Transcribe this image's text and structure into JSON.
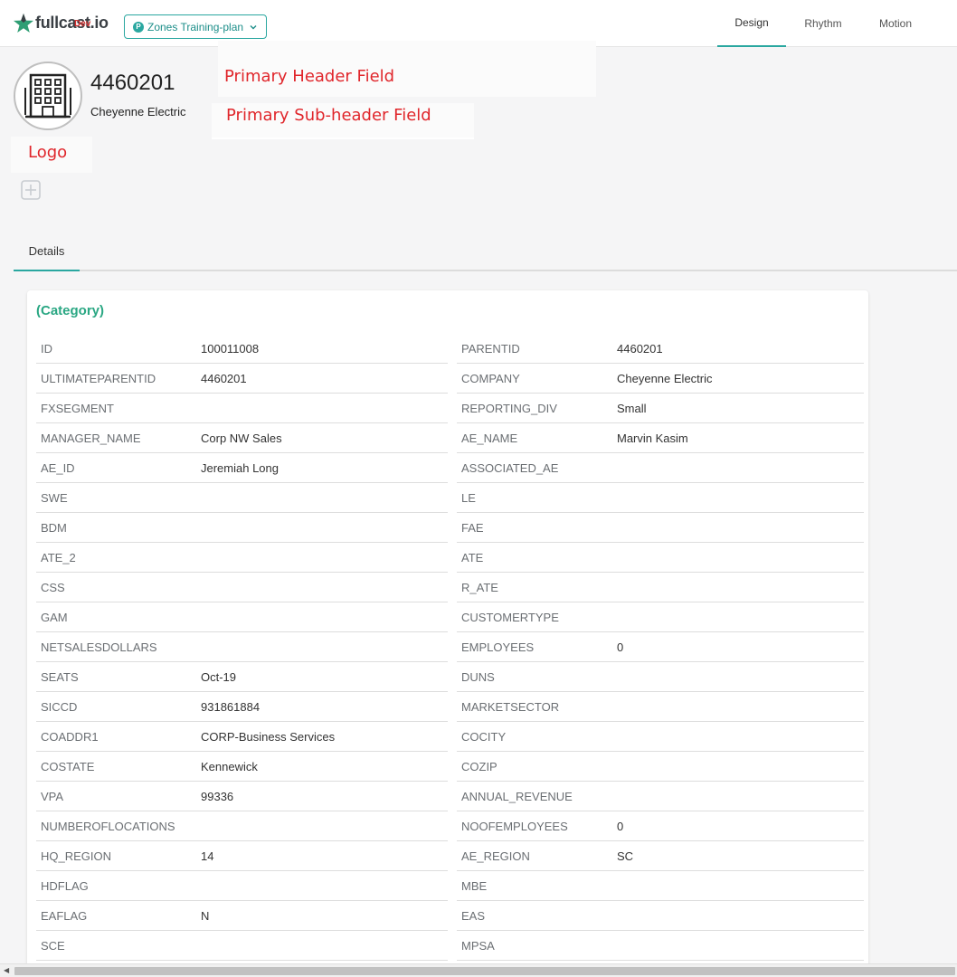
{
  "app": {
    "brand": "fullcast.io",
    "env": "Dev"
  },
  "plan_selector": {
    "badge": "P",
    "label": "Zones Training-plan"
  },
  "nav": [
    {
      "label": "Design",
      "active": true
    },
    {
      "label": "Rhythm",
      "active": false
    },
    {
      "label": "Motion",
      "active": false
    }
  ],
  "record": {
    "id": "4460201",
    "subtitle": "Cheyenne Electric"
  },
  "annotations": {
    "primary_header": "Primary Header Field",
    "primary_subheader": "Primary Sub-header Field",
    "logo": "Logo"
  },
  "tabs": [
    {
      "label": "Details",
      "active": true
    }
  ],
  "card": {
    "title": "(Category)",
    "left": [
      {
        "key": "ID",
        "value": "100011008"
      },
      {
        "key": "ULTIMATEPARENTID",
        "value": "4460201"
      },
      {
        "key": "FXSEGMENT",
        "value": ""
      },
      {
        "key": "MANAGER_NAME",
        "value": "Corp NW Sales"
      },
      {
        "key": "AE_ID",
        "value": "Jeremiah Long"
      },
      {
        "key": "SWE",
        "value": ""
      },
      {
        "key": "BDM",
        "value": ""
      },
      {
        "key": "ATE_2",
        "value": ""
      },
      {
        "key": "CSS",
        "value": ""
      },
      {
        "key": "GAM",
        "value": ""
      },
      {
        "key": "NETSALESDOLLARS",
        "value": ""
      },
      {
        "key": "SEATS",
        "value": "Oct-19"
      },
      {
        "key": "SICCD",
        "value": "931861884"
      },
      {
        "key": "COADDR1",
        "value": "CORP-Business Services"
      },
      {
        "key": "COSTATE",
        "value": "Kennewick"
      },
      {
        "key": "VPA",
        "value": "99336"
      },
      {
        "key": "NUMBEROFLOCATIONS",
        "value": ""
      },
      {
        "key": "HQ_REGION",
        "value": "14"
      },
      {
        "key": "HDFLAG",
        "value": ""
      },
      {
        "key": "EAFLAG",
        "value": "N"
      },
      {
        "key": "SCE",
        "value": ""
      }
    ],
    "right": [
      {
        "key": "PARENTID",
        "value": "4460201"
      },
      {
        "key": "COMPANY",
        "value": "Cheyenne Electric"
      },
      {
        "key": "REPORTING_DIV",
        "value": "Small"
      },
      {
        "key": "AE_NAME",
        "value": "Marvin Kasim"
      },
      {
        "key": "ASSOCIATED_AE",
        "value": ""
      },
      {
        "key": "LE",
        "value": ""
      },
      {
        "key": "FAE",
        "value": ""
      },
      {
        "key": "ATE",
        "value": ""
      },
      {
        "key": "R_ATE",
        "value": ""
      },
      {
        "key": "CUSTOMERTYPE",
        "value": ""
      },
      {
        "key": "EMPLOYEES",
        "value": "0"
      },
      {
        "key": "DUNS",
        "value": ""
      },
      {
        "key": "MARKETSECTOR",
        "value": ""
      },
      {
        "key": "COCITY",
        "value": ""
      },
      {
        "key": "COZIP",
        "value": ""
      },
      {
        "key": "ANNUAL_REVENUE",
        "value": ""
      },
      {
        "key": "NOOFEMPLOYEES",
        "value": "0"
      },
      {
        "key": "AE_REGION",
        "value": "SC"
      },
      {
        "key": "MBE",
        "value": ""
      },
      {
        "key": "EAS",
        "value": ""
      },
      {
        "key": "MPSA",
        "value": ""
      }
    ]
  },
  "colors": {
    "accent": "#2aa7a0",
    "category": "#2aa783",
    "annotation": "#e0262b",
    "env": "#d32f2f"
  }
}
